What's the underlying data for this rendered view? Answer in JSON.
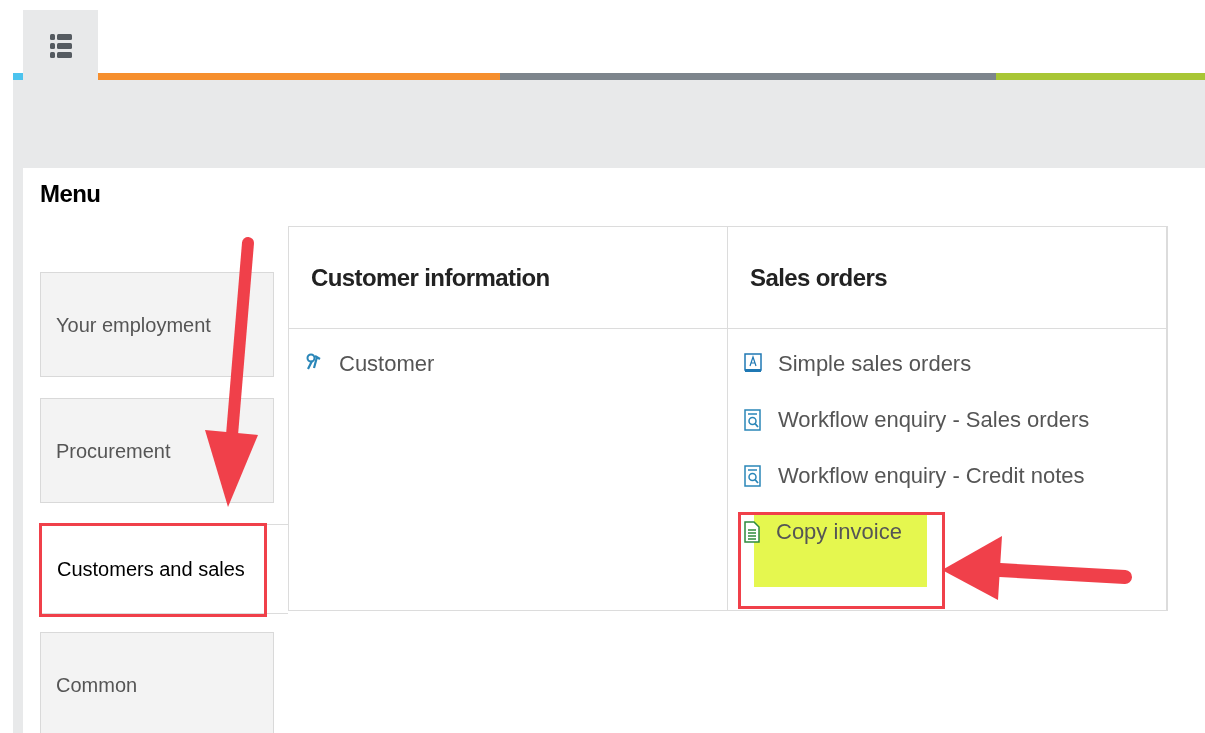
{
  "menu_title": "Menu",
  "sidebar": {
    "items": [
      {
        "label": "Your employment",
        "selected": false
      },
      {
        "label": "Procurement",
        "selected": false
      },
      {
        "label": "Customers and sales",
        "selected": true
      },
      {
        "label": "Common",
        "selected": false
      }
    ]
  },
  "columns": [
    {
      "heading": "Customer information",
      "items": [
        {
          "label": "Customer",
          "kind": "customer",
          "highlighted": false
        }
      ]
    },
    {
      "heading": "Sales orders",
      "items": [
        {
          "label": "Simple sales orders",
          "kind": "form",
          "highlighted": false
        },
        {
          "label": "Workflow enquiry - Sales orders",
          "kind": "enquiry",
          "highlighted": false
        },
        {
          "label": "Workflow enquiry - Credit notes",
          "kind": "enquiry",
          "highlighted": false
        },
        {
          "label": "Copy invoice",
          "kind": "document",
          "highlighted": true
        }
      ]
    }
  ]
}
